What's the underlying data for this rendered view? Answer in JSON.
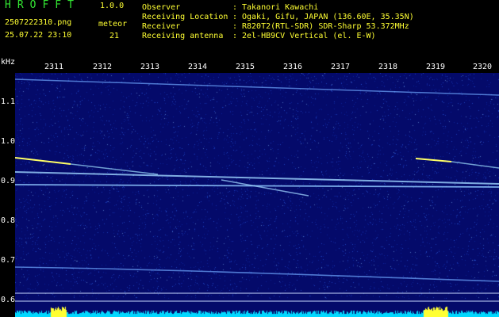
{
  "app": {
    "title": "HROFFT",
    "version": "1.0.0"
  },
  "file": {
    "name": "2507222310.png",
    "datetime": "25.07.22 23:10"
  },
  "meteor": {
    "label": "meteor",
    "count": "21"
  },
  "info": [
    {
      "label": "Observer",
      "colon": ":",
      "value": "Takanori Kawachi"
    },
    {
      "label": "Receiving Location",
      "colon": ":",
      "value": "Ogaki, Gifu, JAPAN (136.60E, 35.35N)"
    },
    {
      "label": "Receiver",
      "colon": ":",
      "value": "R820T2(RTL-SDR) SDR-Sharp 53.372MHz"
    },
    {
      "label": "Receiving antenna",
      "colon": ":",
      "value": "2el-HB9CV Vertical (el. E-W)"
    }
  ],
  "axis": {
    "unit": "kHz",
    "minute_labels": [
      "2311",
      "2312",
      "2313",
      "2314",
      "2315",
      "2316",
      "2317",
      "2318",
      "2319",
      "2320"
    ],
    "freq_labels": [
      "1.1",
      "1.0",
      "0.9",
      "0.8",
      "0.7",
      "0.6"
    ]
  },
  "colors": {
    "background": "#000000",
    "plot_background": "#040a6a",
    "signal": "#8fd0ff",
    "strong_signal": "#ffff33",
    "floor": "#00e0ff",
    "header_text": "#33e633",
    "info_text": "#ffff33",
    "axis_text": "#ffffff"
  }
}
